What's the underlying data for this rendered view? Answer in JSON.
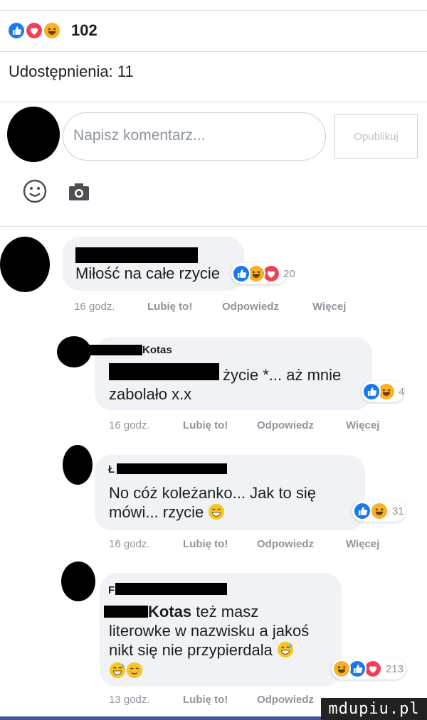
{
  "reactions": {
    "total_count": "102",
    "shares_label": "Udostępnienia: 11"
  },
  "composer": {
    "placeholder": "Napisz komentarz...",
    "publish_label": "Opublikuj"
  },
  "comments": [
    {
      "text": "Miłość na całe rzycie",
      "reaction_count": "20",
      "reactions": [
        "like-icon",
        "haha-icon",
        "love-icon"
      ],
      "time": "16 godz.",
      "like": "Lubię to!",
      "reply": "Odpowiedz",
      "more": "Więcej"
    },
    {
      "author_suffix": "Kotas",
      "line1": "życie *... aż mnie",
      "line2": "zabolało x.x",
      "reaction_count": "4",
      "reactions": [
        "like-icon",
        "haha-icon"
      ],
      "time": "16 godz.",
      "like": "Lubię to!",
      "reply": "Odpowiedz",
      "more": "Więcej"
    },
    {
      "author_initial": "Ł",
      "line1": "No cóż koleżanko... Jak to się",
      "line2": "mówi... rzycie",
      "reaction_count": "31",
      "reactions": [
        "like-icon",
        "haha-icon"
      ],
      "time": "16 godz.",
      "like": "Lubię to!",
      "reply": "Odpowiedz",
      "more": "Więcej"
    },
    {
      "author_initial": "F",
      "mention": "Kotas",
      "line1_suffix": "też masz",
      "line2": "literowke w nazwisku a jakoś",
      "line3": "nikt się nie przypierdala",
      "reaction_count": "213",
      "reactions": [
        "haha-icon",
        "like-icon",
        "love-icon"
      ],
      "time": "13 godz.",
      "like": "Lubię to!",
      "reply": "Odpowiedz"
    }
  ],
  "watermark": "mdupiu.pl",
  "colors": {
    "like": "#1877f2",
    "love": "#f33e58",
    "haha": "#f7b125",
    "bubble": "#f0f2f5",
    "meta": "#90949c"
  }
}
